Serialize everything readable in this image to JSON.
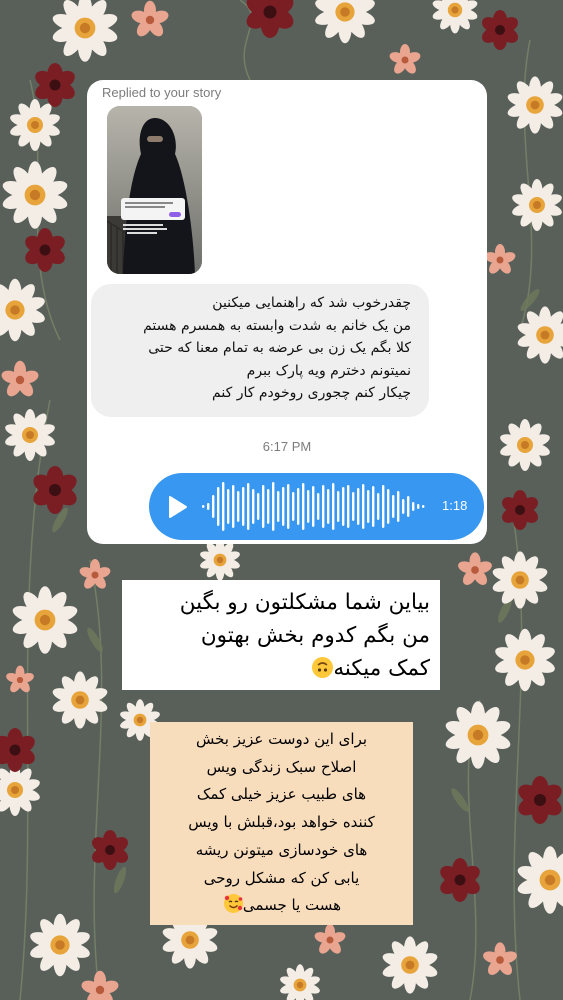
{
  "story_reply": {
    "header": "Replied to your story",
    "thumbnail_icon": "story-thumbnail"
  },
  "message": {
    "lines": [
      "چقدرخوب شد که راهنمایی میکنین",
      "من یک خانم به شدت وابسته به همسرم هستم",
      "کلا بگم یک زن بی عرضه به تمام معنا که حتی",
      "نمیتونم دخترم ویه پارک ببرم",
      "چیکار کنم چجوری روخودم کار کنم"
    ]
  },
  "timestamp": "6:17 PM",
  "voice_message": {
    "duration": "1:18",
    "icon": "play-icon",
    "color": "#3897f0"
  },
  "caption_top": {
    "lines": [
      "بیاین شما مشکلتون رو بگین",
      "من بگم کدوم بخش بهتون",
      "کمک میکنه"
    ],
    "emoji": "upside-down-face"
  },
  "caption_bottom": {
    "lines": [
      "برای این دوست عزیز بخش",
      "اصلاح سبک زندگی ویس",
      "های طبیب عزیز خیلی کمک",
      "کننده خواهد بود،قبلش با ویس",
      "های خودسازی میتونن ریشه",
      "یابی کن که مشکل روحی",
      "هست یا جسمی"
    ],
    "emoji": "smiling-face-with-hearts",
    "background": "#f8ddbd"
  },
  "colors": {
    "wallpaper": "#59605a",
    "bubble_in": "#efefef",
    "accent": "#3897f0"
  }
}
